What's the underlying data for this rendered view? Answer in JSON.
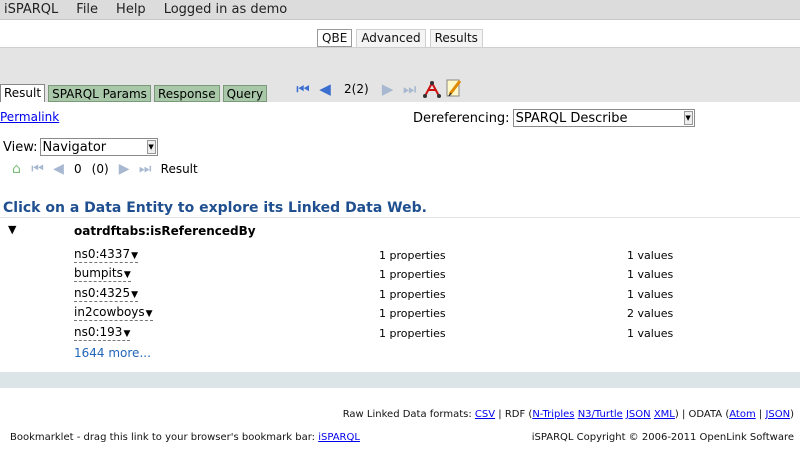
{
  "menubar": {
    "app": "iSPARQL",
    "file": "File",
    "help": "Help",
    "login": "Logged in as demo"
  },
  "mode_tabs": [
    "QBE",
    "Advanced",
    "Results"
  ],
  "result_tabs": [
    "Result",
    "SPARQL Params",
    "Response",
    "Query"
  ],
  "pager": "2(2)",
  "permalink": "Permalink",
  "dereferencing": {
    "label": "Dereferencing:",
    "value": "SPARQL Describe"
  },
  "view": {
    "label": "View:",
    "value": "Navigator"
  },
  "subnav": {
    "position": "0",
    "count": "(0)",
    "label": "Result"
  },
  "headline": "Click on a Data Entity to explore its Linked Data Web.",
  "tree": {
    "title": "oatrdftabs:isReferencedBy",
    "rows": [
      {
        "name": "ns0:4337",
        "props": "1 properties",
        "vals": "1 values"
      },
      {
        "name": "bumpits",
        "props": "1 properties",
        "vals": "1 values"
      },
      {
        "name": "ns0:4325",
        "props": "1 properties",
        "vals": "1 values"
      },
      {
        "name": "in2cowboys",
        "props": "1 properties",
        "vals": "2 values"
      },
      {
        "name": "ns0:193",
        "props": "1 properties",
        "vals": "1 values"
      }
    ],
    "more": "1644 more..."
  },
  "footer": {
    "raw_prefix": "Raw Linked Data formats:",
    "csv": "CSV",
    "rdf_label": "RDF (",
    "ntriples": "N-Triples",
    "n3": "N3/Turtle",
    "json": "JSON",
    "xml": "XML",
    "odata_label": ") | ODATA (",
    "atom": "Atom",
    "json2": "JSON",
    "bookmarklet_text": "Bookmarklet - drag this link to your browser's bookmark bar:",
    "bookmarklet_link": "iSPARQL",
    "copyright": "iSPARQL Copyright © 2006-2011 OpenLink Software"
  },
  "icons": {
    "first": "first-page-icon",
    "prev": "previous-page-icon",
    "next": "next-page-icon",
    "last": "last-page-icon",
    "graph": "graph-icon",
    "edit": "edit-pencil-icon",
    "home": "home-icon"
  }
}
